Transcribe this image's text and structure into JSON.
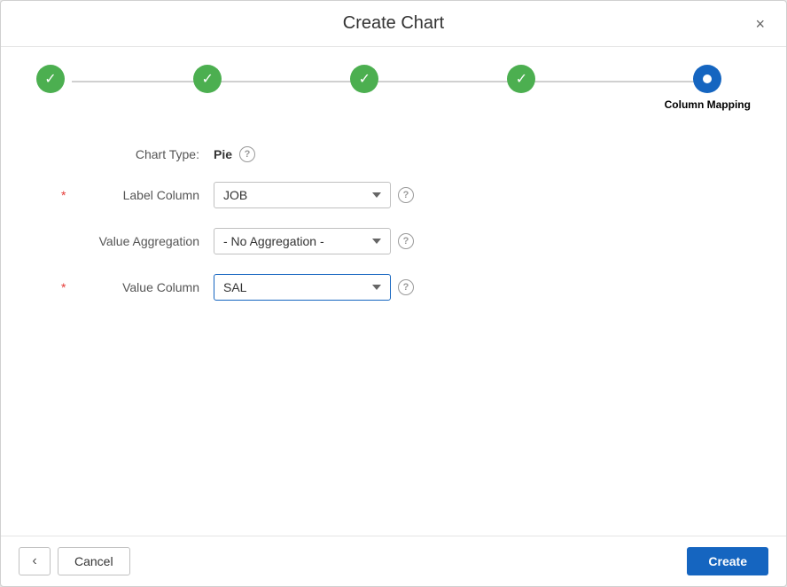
{
  "dialog": {
    "title": "Create Chart",
    "close_label": "×"
  },
  "stepper": {
    "steps": [
      {
        "id": "step1",
        "state": "completed",
        "label": ""
      },
      {
        "id": "step2",
        "state": "completed",
        "label": ""
      },
      {
        "id": "step3",
        "state": "completed",
        "label": ""
      },
      {
        "id": "step4",
        "state": "completed",
        "label": ""
      },
      {
        "id": "step5",
        "state": "active",
        "label": "Column Mapping"
      }
    ]
  },
  "form": {
    "chart_type_label": "Chart Type:",
    "chart_type_value": "Pie",
    "label_column_label": "Label Column",
    "label_column_value": "JOB",
    "value_aggregation_label": "Value Aggregation",
    "value_aggregation_value": "- No Aggregation -",
    "value_column_label": "Value Column",
    "value_column_value": "SAL"
  },
  "footer": {
    "back_icon": "‹",
    "cancel_label": "Cancel",
    "create_label": "Create"
  }
}
